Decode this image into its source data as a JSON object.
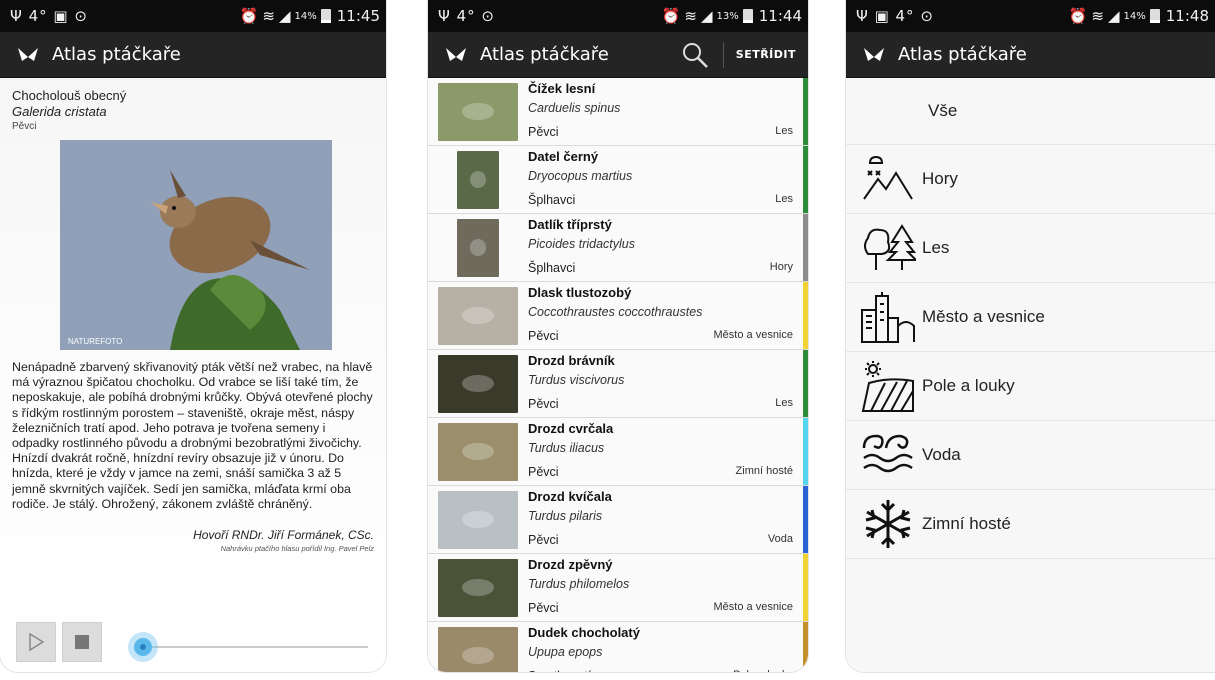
{
  "status_bars": [
    {
      "icons": "Ψ 4° ▣ ⊙",
      "pct": "14%",
      "time": "11:45"
    },
    {
      "icons": "Ψ 4° ⊙",
      "pct": "13%",
      "time": "11:44"
    },
    {
      "icons": "Ψ ▣ 4° ⊙",
      "pct": "14%",
      "time": "11:48"
    }
  ],
  "app": {
    "title": "Atlas ptáčkaře",
    "sort_label": "SETŘÍDIT"
  },
  "detail": {
    "common_name": "Chocholouš obecný",
    "latin_name": "Galerida cristata",
    "order": "Pěvci",
    "photo_credit": "NATUREFOTO",
    "description": "Nenápadně zbarvený skřivanovitý pták větší než vrabec, na hlavě má výraznou špičatou chocholku. Od vrabce se liší také tím, že neposkakuje, ale pobíhá drobnými krůčky. Obývá otevřené plochy s řídkým rostlinným porostem – staveniště, okraje měst, náspy železničních tratí apod. Jeho potrava je tvořena semeny i odpadky rostlinného původu a drobnými bezobratlými živočichy. Hnízdí dvakrát ročně, hnízdní revíry obsazuje již v únoru. Do hnízda, které je vždy v jamce na zemi, snáší samička 3 až 5 jemně skvrnitých vajíček. Sedí jen samička, mláďata krmí oba rodiče. Je stálý. Ohrožený, zákonem zvláště chráněný.",
    "speaker": "Hovoří RNDr. Jiří Formánek, CSc.",
    "recorded": "Nahrávku ptačího hlasu pořídil Ing. Pavel Pelz"
  },
  "birds": [
    {
      "name": "Čížek lesní",
      "latin": "Carduelis spinus",
      "order": "Pěvci",
      "habitat": "Les",
      "color": "#2e8b3a",
      "bg": "#8a9a6a"
    },
    {
      "name": "Datel černý",
      "latin": "Dryocopus martius",
      "order": "Šplhavci",
      "habitat": "Les",
      "color": "#2e8b3a",
      "bg": "#5a6a48"
    },
    {
      "name": "Datlík tříprstý",
      "latin": "Picoides tridactylus",
      "order": "Šplhavci",
      "habitat": "Hory",
      "color": "#8c8c8c",
      "bg": "#6e6a5c"
    },
    {
      "name": "Dlask tlustozobý",
      "latin": "Coccothraustes coccothraustes",
      "order": "Pěvci",
      "habitat": "Město a vesnice",
      "color": "#f3d233",
      "bg": "#b7b0a4"
    },
    {
      "name": "Drozd brávník",
      "latin": "Turdus viscivorus",
      "order": "Pěvci",
      "habitat": "Les",
      "color": "#2e8b3a",
      "bg": "#3a3a2a"
    },
    {
      "name": "Drozd cvrčala",
      "latin": "Turdus iliacus",
      "order": "Pěvci",
      "habitat": "Zimní hosté",
      "color": "#54d6f0",
      "bg": "#9a8f6a"
    },
    {
      "name": "Drozd kvíčala",
      "latin": "Turdus pilaris",
      "order": "Pěvci",
      "habitat": "Voda",
      "color": "#2a62d8",
      "bg": "#b8c0c4"
    },
    {
      "name": "Drozd zpěvný",
      "latin": "Turdus philomelos",
      "order": "Pěvci",
      "habitat": "Město a vesnice",
      "color": "#f3d233",
      "bg": "#4a5238"
    },
    {
      "name": "Dudek chocholatý",
      "latin": "Upupa epops",
      "order": "Srostloprstí",
      "habitat": "Pole a louky",
      "color": "#c4902a",
      "bg": "#9a8a6a"
    }
  ],
  "habitats": [
    {
      "label": "Vše",
      "icon": "all"
    },
    {
      "label": "Hory",
      "icon": "mountains-icon"
    },
    {
      "label": "Les",
      "icon": "forest-icon"
    },
    {
      "label": "Město a vesnice",
      "icon": "city-icon"
    },
    {
      "label": "Pole a louky",
      "icon": "fields-icon"
    },
    {
      "label": "Voda",
      "icon": "water-icon"
    },
    {
      "label": "Zimní hosté",
      "icon": "snowflake-icon"
    }
  ]
}
